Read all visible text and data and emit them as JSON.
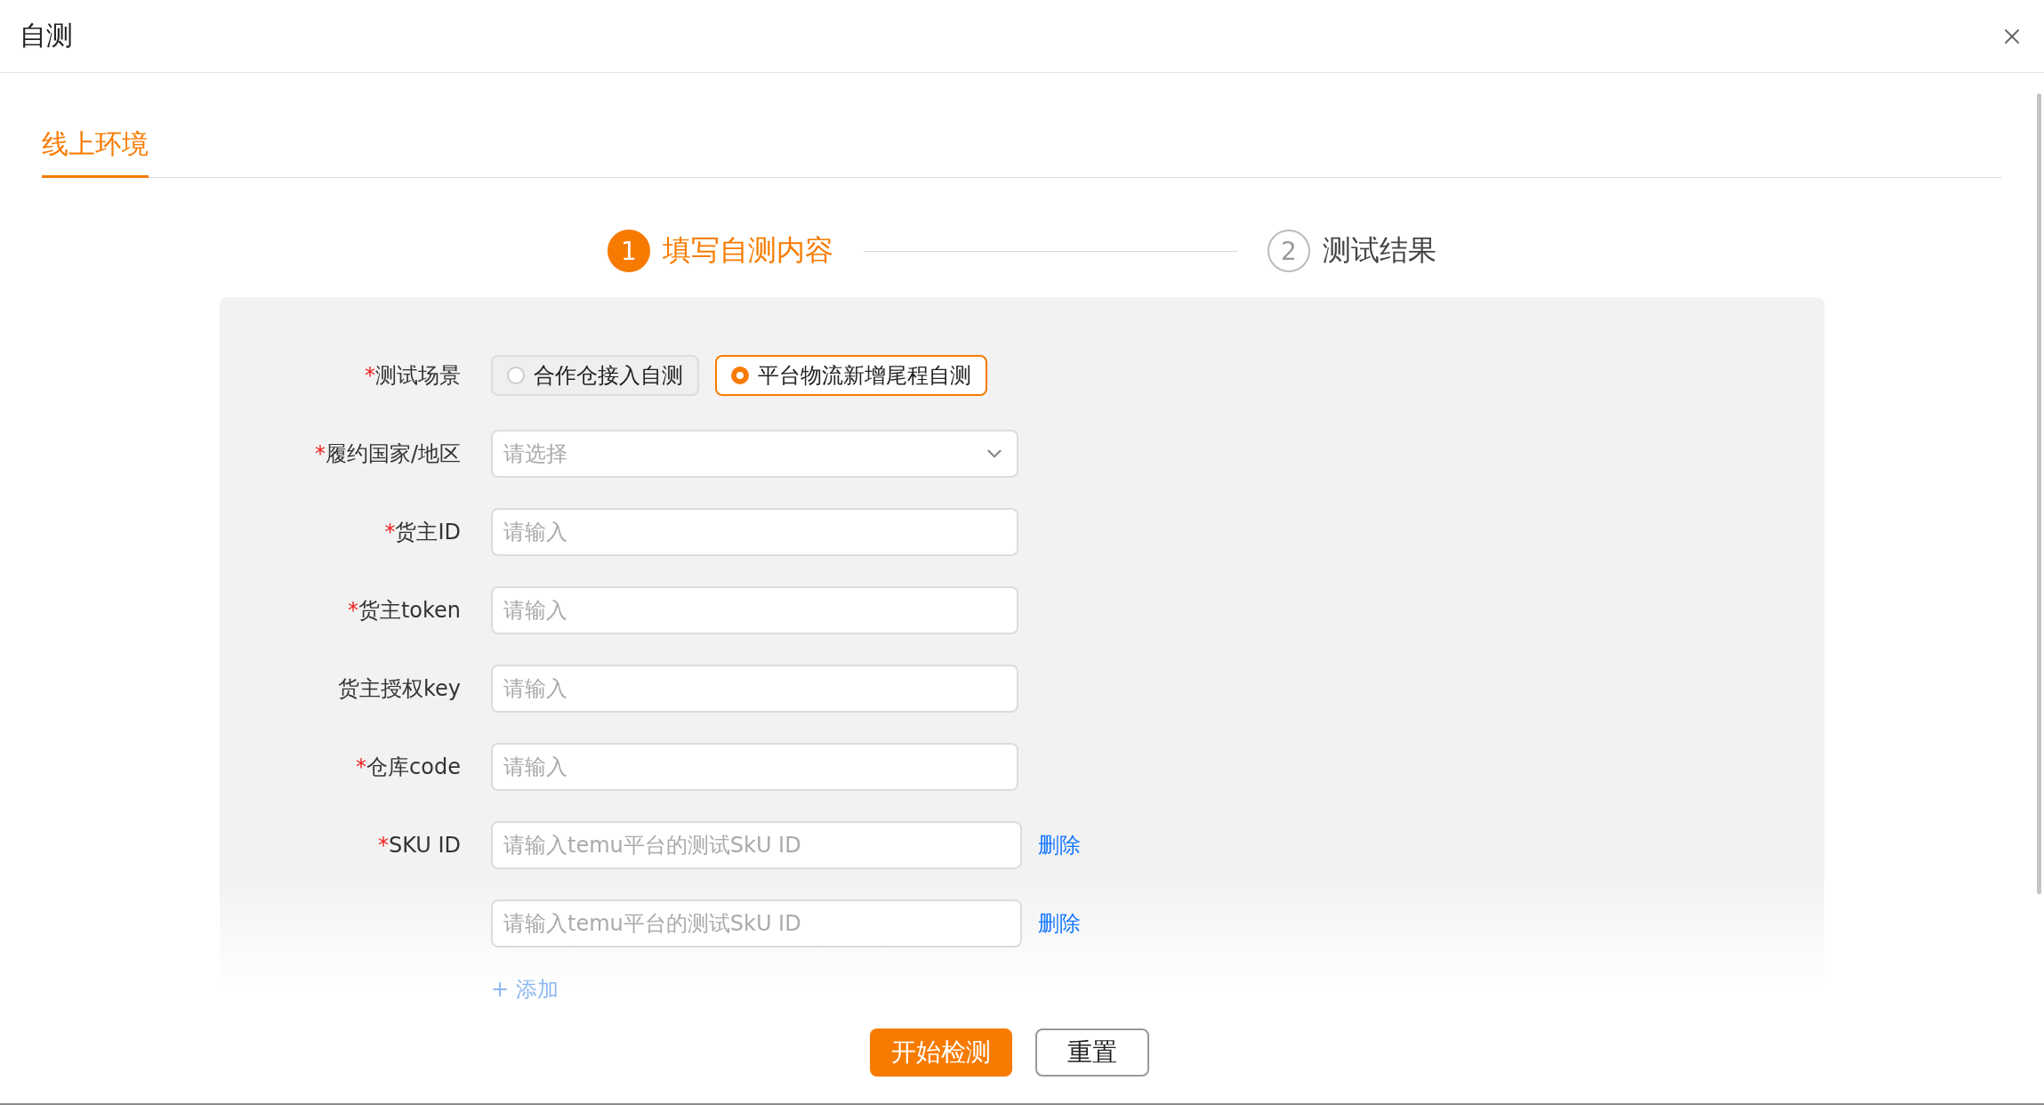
{
  "dialog": {
    "title": "自测"
  },
  "tabs": [
    {
      "label": "线上环境",
      "selected": true
    }
  ],
  "steps": [
    {
      "number": "1",
      "label": "填写自测内容",
      "selected": true
    },
    {
      "number": "2",
      "label": "测试结果",
      "selected": false
    }
  ],
  "form": {
    "fields": [
      {
        "kind": "radio",
        "mark": "*",
        "label": "测试场景",
        "options": [
          {
            "label": "合作仓接入自测",
            "selected": false
          },
          {
            "label": "平台物流新增尾程自测",
            "selected": true
          }
        ]
      },
      {
        "kind": "select",
        "mark": "*",
        "label": "履约国家/地区",
        "placeholder": "请选择"
      },
      {
        "kind": "input",
        "mark": "*",
        "label": "货主ID",
        "placeholder": "请输入"
      },
      {
        "kind": "input",
        "mark": "*",
        "label": "货主token",
        "placeholder": "请输入"
      },
      {
        "kind": "input",
        "label": "货主授权key",
        "placeholder": "请输入"
      },
      {
        "kind": "input",
        "mark": "*",
        "label": "仓库code",
        "placeholder": "请输入"
      },
      {
        "kind": "list",
        "mark": "*",
        "label": "SKU ID",
        "entries": [
          {
            "placeholder": "请输入temu平台的测试SkU ID",
            "action": "删除"
          },
          {
            "placeholder": "请输入temu平台的测试SkU ID",
            "action": "删除"
          }
        ],
        "add": "+ 添加"
      }
    ]
  },
  "buttons": [
    {
      "label": "开始检测",
      "kind": "primary"
    },
    {
      "label": "重置",
      "kind": "default"
    }
  ]
}
